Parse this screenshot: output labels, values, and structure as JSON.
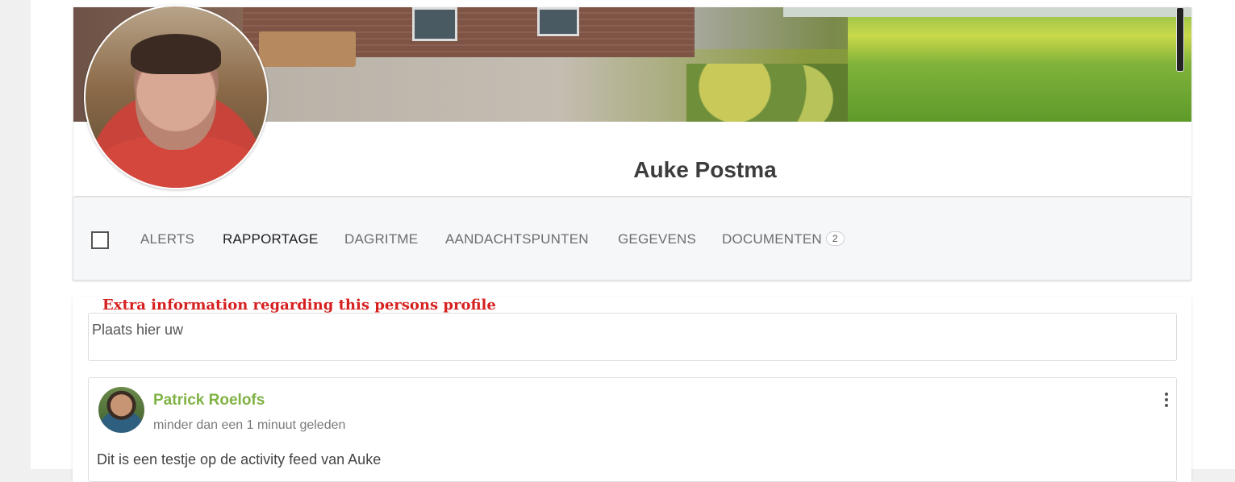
{
  "profile": {
    "name": "Auke Postma"
  },
  "tabs": [
    {
      "label": "ALERTS",
      "active": false
    },
    {
      "label": "RAPPORTAGE",
      "active": true
    },
    {
      "label": "DAGRITME",
      "active": false
    },
    {
      "label": "AANDACHTSPUNTEN",
      "active": false
    },
    {
      "label": "GEGEVENS",
      "active": false
    },
    {
      "label": "DOCUMENTEN",
      "active": false,
      "badge": "2"
    }
  ],
  "annotation": "Extra information regarding this persons profile",
  "note_input": {
    "text": "Plaats hier uw",
    "overflow_text": "..."
  },
  "post": {
    "author": "Patrick Roelofs",
    "time": "minder dan een 1 minuut geleden",
    "body": "Dit is een testje op de activity feed van Auke"
  },
  "colors": {
    "accent_green": "#7fb243",
    "annotation_red": "#d62020",
    "active_tab": "#1d1d1d"
  }
}
